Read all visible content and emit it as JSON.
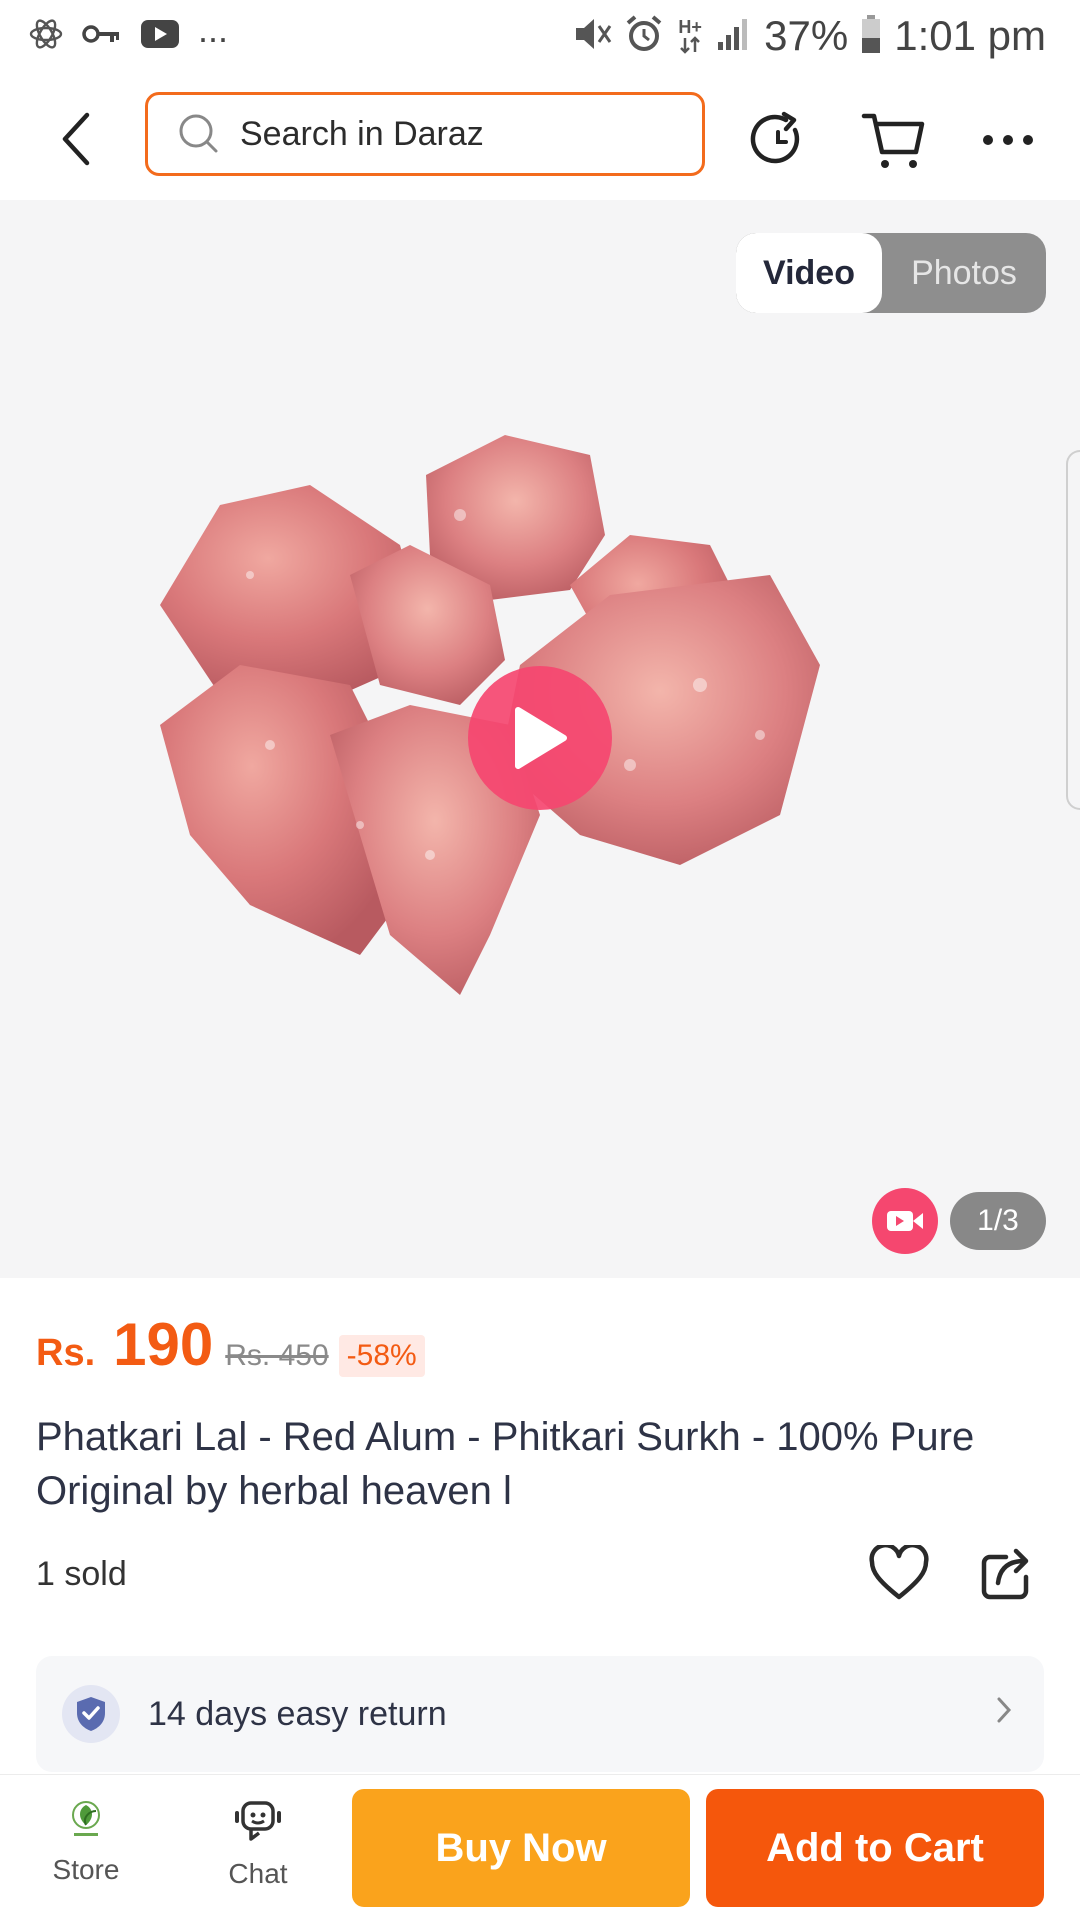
{
  "status_bar": {
    "battery": "37%",
    "time": "1:01 pm",
    "more": "...",
    "network": "H+"
  },
  "header": {
    "search_placeholder": "Search in Daraz",
    "icons": [
      "back-icon",
      "search-icon",
      "history-icon",
      "cart-icon",
      "more-icon"
    ]
  },
  "media": {
    "tab_video": "Video",
    "tab_photos": "Photos",
    "selected_tab": "Video",
    "counter": "1/3"
  },
  "product": {
    "currency": "Rs.",
    "price": "190",
    "original_price": "Rs. 450",
    "discount": "-58%",
    "title": "Phatkari Lal  - Red Alum - Phitkari Surkh  - 100% Pure Original by herbal heaven l",
    "sold": "1 sold"
  },
  "return_policy": {
    "text": "14 days easy return"
  },
  "bottom_bar": {
    "store_label": "Store",
    "chat_label": "Chat",
    "buy_now": "Buy Now",
    "add_to_cart": "Add to Cart"
  },
  "colors": {
    "accent": "#f35b13",
    "buy_now": "#faa31c",
    "add_to_cart": "#f5570c",
    "video_pink": "#f5476f"
  }
}
